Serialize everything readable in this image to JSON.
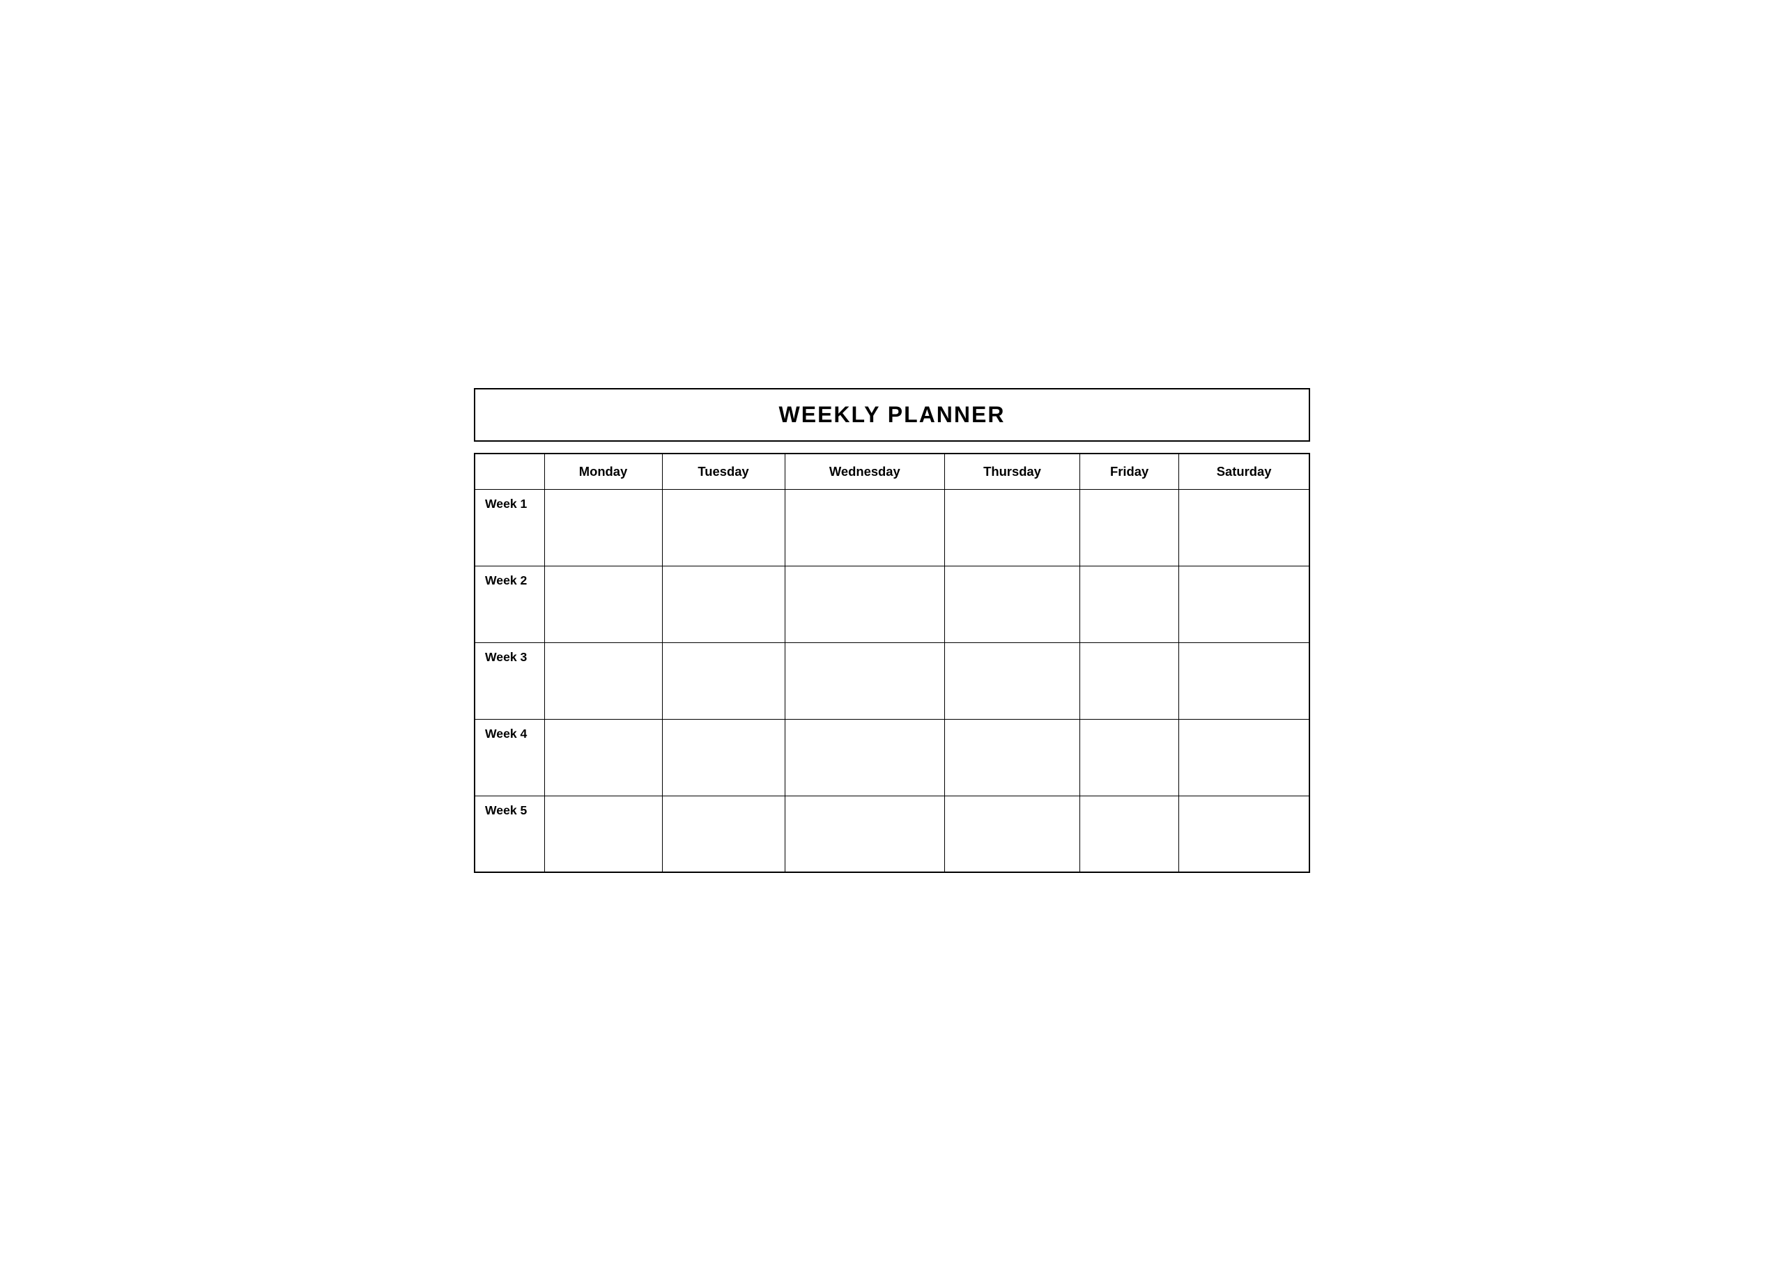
{
  "title": "WEEKLY PLANNER",
  "columns": {
    "empty": "",
    "headers": [
      "Monday",
      "Tuesday",
      "Wednesday",
      "Thursday",
      "Friday",
      "Saturday"
    ]
  },
  "rows": [
    {
      "label": "Week 1"
    },
    {
      "label": "Week 2"
    },
    {
      "label": "Week 3"
    },
    {
      "label": "Week 4"
    },
    {
      "label": "Week 5"
    }
  ]
}
